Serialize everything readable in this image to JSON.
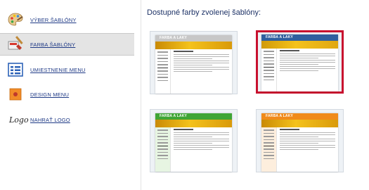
{
  "sidebar": {
    "items": [
      {
        "label": "VÝBER ŠABLÓNY",
        "icon": "palette-icon"
      },
      {
        "label": "FARBA ŠABLÓNY",
        "icon": "paint-brush-icon"
      },
      {
        "label": "UMIESTNENIE MENU",
        "icon": "menu-layout-icon"
      },
      {
        "label": "DESIGN MENU",
        "icon": "design-menu-icon"
      },
      {
        "label": "NAHRAŤ LOGO",
        "icon_text": "Logo"
      }
    ],
    "active_item": "FARBA ŠABLÓNY"
  },
  "main": {
    "title": "Dostupné farby zvolenej šablóny:",
    "templates": [
      {
        "brand": "FARBA A LAKY",
        "color": "#c7c7c7",
        "band": "#e0a710",
        "selected": false
      },
      {
        "brand": "FARBA A LAKY",
        "color": "#2f5f9e",
        "band": "#e8b114",
        "selected": true
      },
      {
        "brand": "FARBA A LAKY",
        "color": "#3fa535",
        "band": "#e0a710",
        "selected": false
      },
      {
        "brand": "FARBA A LAKY",
        "color": "#f08a1a",
        "band": "#e0a710",
        "selected": false
      }
    ]
  },
  "colors": {
    "link": "#1f3a86",
    "title": "#1d3266",
    "selected_border": "#c8102e",
    "active_bg": "#e4e4e4"
  }
}
